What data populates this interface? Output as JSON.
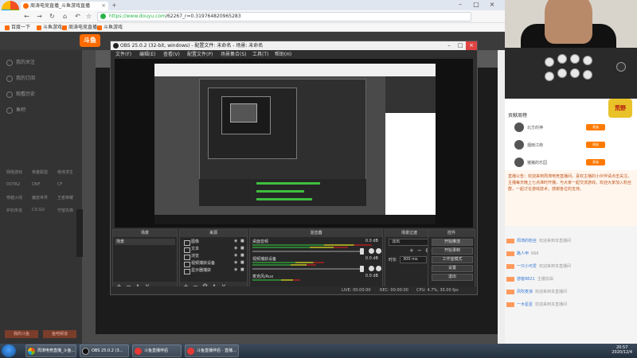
{
  "browser": {
    "tab_title": "周涛电竞直播_斗鱼游戏直播",
    "new_tab": "+",
    "url_host": "https://www.douyu.com",
    "url_path": "/62267_r=0.319764820965283",
    "nav_icons": [
      "back-icon",
      "forward-icon",
      "reload-icon",
      "home-icon",
      "undo-icon",
      "star-icon"
    ],
    "bookmarks": [
      "百度一下",
      "斗鱼游戏",
      "周涛电竞直播",
      "斗鱼游戏"
    ]
  },
  "sidebar": {
    "items": [
      "我的关注",
      "我的订阅",
      "观看历史",
      "鱼吧"
    ],
    "categories": [
      [
        "网络游戏",
        "英雄联盟",
        "绝地求生"
      ],
      [
        "DOTA2",
        "DNF",
        "CF"
      ],
      [
        "穿越火线",
        "魔兽世界",
        "王者荣耀"
      ],
      [
        "炉石传说",
        "CS:GO",
        "守望先锋"
      ]
    ],
    "bottom_buttons": [
      "我的斗鱼",
      "鱼吧频道"
    ]
  },
  "obs": {
    "title": "OBS 25.0.2 (32-bit, windows) - 配置文件: 未命名 - 场景: 未命名",
    "menu": [
      "文件(F)",
      "编辑(E)",
      "查看(V)",
      "配置文件(P)",
      "场景集合(S)",
      "工具(T)",
      "帮助(H)"
    ],
    "docks": {
      "scenes": {
        "header": "场景",
        "items": [
          "场景"
        ]
      },
      "sources": {
        "header": "来源",
        "items": [
          "图像",
          "文本",
          "浏览",
          "视频捕获设备",
          "显示器捕获"
        ]
      },
      "mixer": {
        "header": "混音器",
        "rows": [
          {
            "name": "桌面音频",
            "db": "0.0 dB"
          },
          {
            "name": "视频捕获设备",
            "db": "0.0 dB"
          },
          {
            "name": "麦克风/Aux",
            "db": "0.0 dB"
          }
        ]
      },
      "transitions": {
        "header": "场景过渡",
        "select": "淡出",
        "duration_label": "时长",
        "duration": "300 ms"
      },
      "controls": {
        "header": "控件",
        "buttons": [
          "开始推流",
          "开始录制",
          "工作室模式",
          "设置",
          "退出"
        ]
      }
    },
    "status": {
      "live": "LIVE: 00:00:00",
      "rec": "REC: 00:00:00",
      "cpu": "CPU: 4.7%, 30.00 fps"
    }
  },
  "right_panel": {
    "rank_title": "贡献周榜",
    "rank_rows": [
      {
        "name": "北方的神",
        "badge": "贵族"
      },
      {
        "name": "烟雨江南",
        "badge": "贵族"
      },
      {
        "name": "猪猪的乐园",
        "badge": "贵族"
      }
    ],
    "gift_logo": "荒野",
    "notice": "直播公告：欢迎来到周涛电竞直播间，喜欢主播的小伙伴请点击关注，主播每天晚上七点准时开播，与大家一起交流游戏，欢迎大家加入粉丝群，一起讨论游戏技术，感谢各位的支持。",
    "chat": [
      {
        "user": "周涛的粉丝",
        "text": "欢迎来到本直播间"
      },
      {
        "user": "路人甲",
        "text": "666"
      },
      {
        "user": "一只小可爱",
        "text": "欢迎来到本直播间"
      },
      {
        "user": "游客8821",
        "text": "主播加油"
      },
      {
        "user": "风吹麦浪",
        "text": "欢迎来到本直播间"
      },
      {
        "user": "一木星星",
        "text": "欢迎来到本直播间"
      }
    ]
  },
  "taskbar": {
    "items": [
      "周涛电竞直播_斗鱼...",
      "OBS 25.0.2 (3...",
      "斗鱼直播伴侣",
      "斗鱼直播伴侣 - 直播..."
    ],
    "time": "20:57",
    "date": "2020/12/4"
  }
}
